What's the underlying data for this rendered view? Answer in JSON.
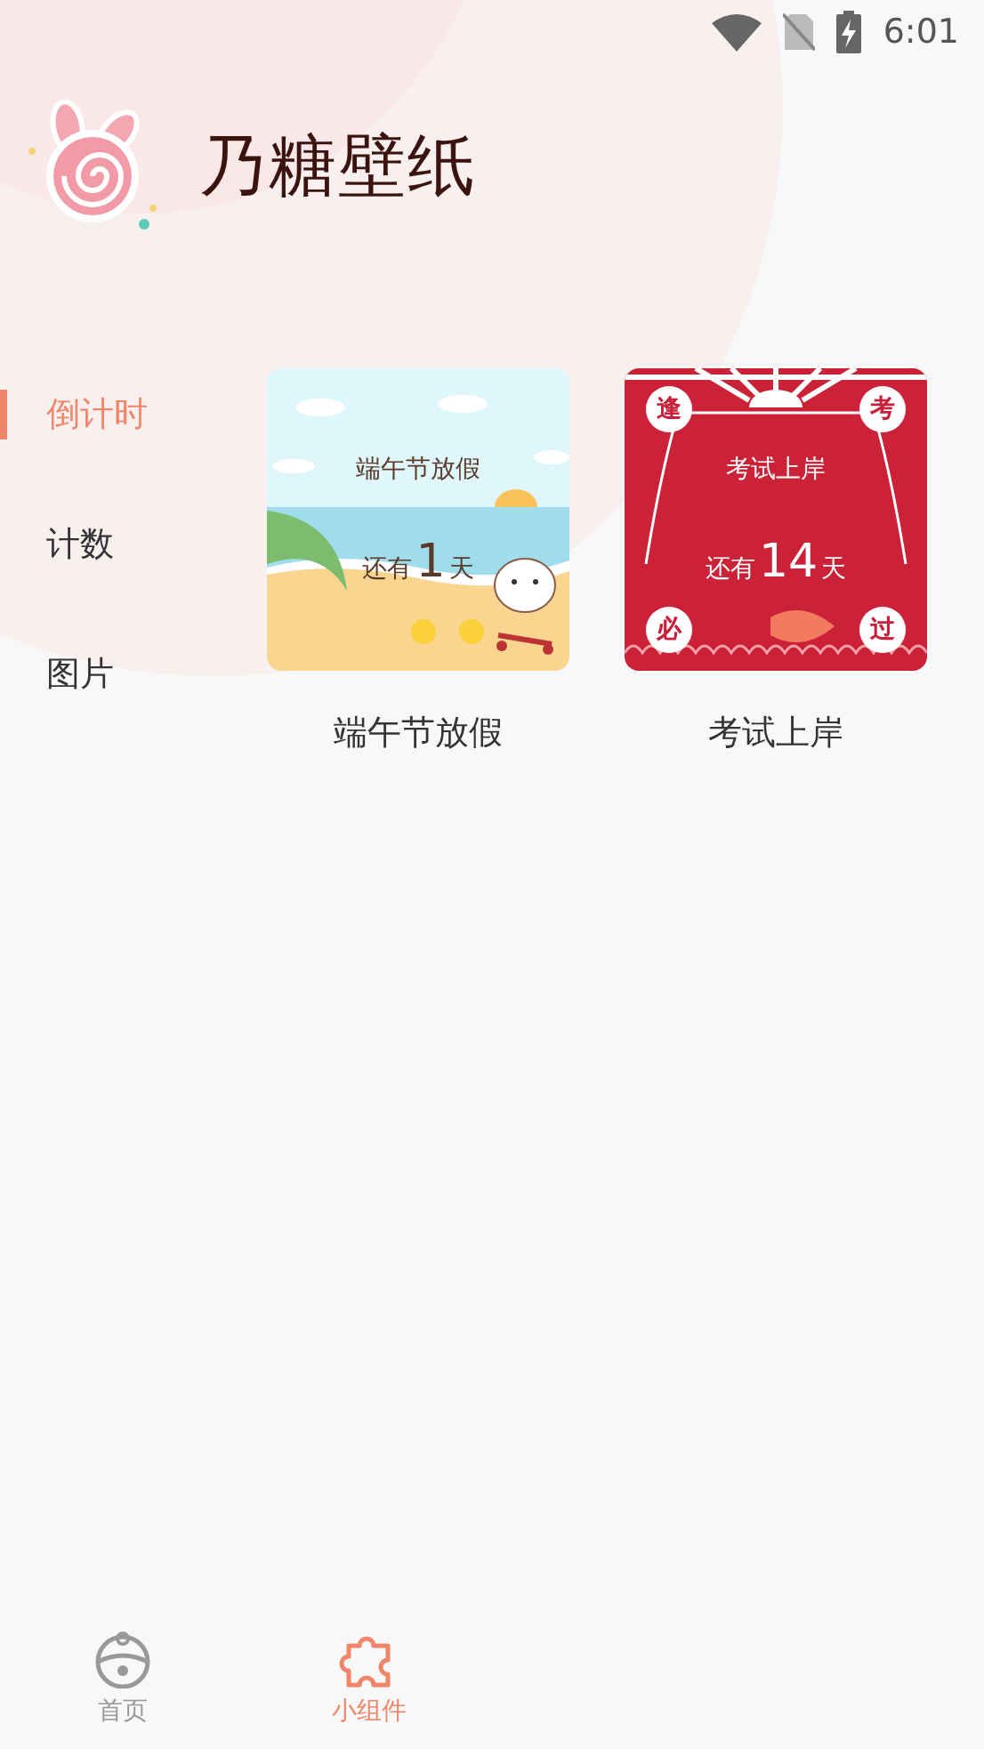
{
  "status_bar": {
    "time": "6:01"
  },
  "app": {
    "title": "乃糖壁纸"
  },
  "sidebar": {
    "items": [
      {
        "label": "倒计时",
        "selected": true
      },
      {
        "label": "计数",
        "selected": false
      },
      {
        "label": "图片",
        "selected": false
      }
    ]
  },
  "widgets": [
    {
      "kind": "beach",
      "preview_title": "端午节放假",
      "prefix": "还有",
      "number": "1",
      "suffix": "天",
      "label": "端午节放假"
    },
    {
      "kind": "exam",
      "preview_title": "考试上岸",
      "prefix": "还有",
      "number": "14",
      "suffix": "天",
      "label": "考试上岸",
      "corners": [
        "逢",
        "考",
        "必",
        "过"
      ]
    }
  ],
  "nav": {
    "items": [
      {
        "label": "首页",
        "kind": "home",
        "selected": false
      },
      {
        "label": "小组件",
        "kind": "widgets",
        "selected": true
      }
    ]
  }
}
